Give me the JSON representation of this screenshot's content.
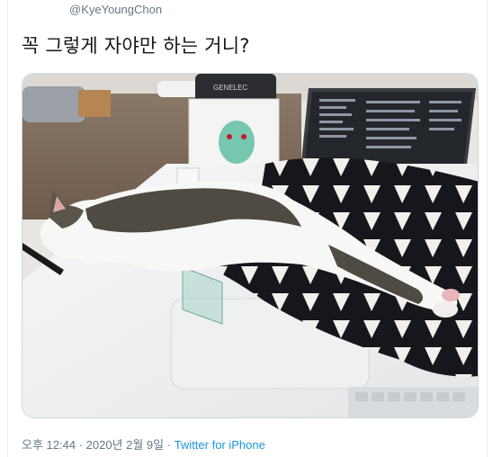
{
  "tweet": {
    "handle": "@KyeYoungChon",
    "text": "꼭 그렇게 자야만 하는 거니?",
    "time": "오후 12:44",
    "separator_1": " · ",
    "date": "2020년 2월 9일",
    "separator_2": " · ",
    "source": "Twitter for iPhone"
  },
  "photo": {
    "monitor_brand": "GENELEC"
  },
  "colors": {
    "link": "#1b95e0",
    "secondary_text": "#657786",
    "primary_text": "#14171a",
    "border": "#ccd6dd"
  }
}
